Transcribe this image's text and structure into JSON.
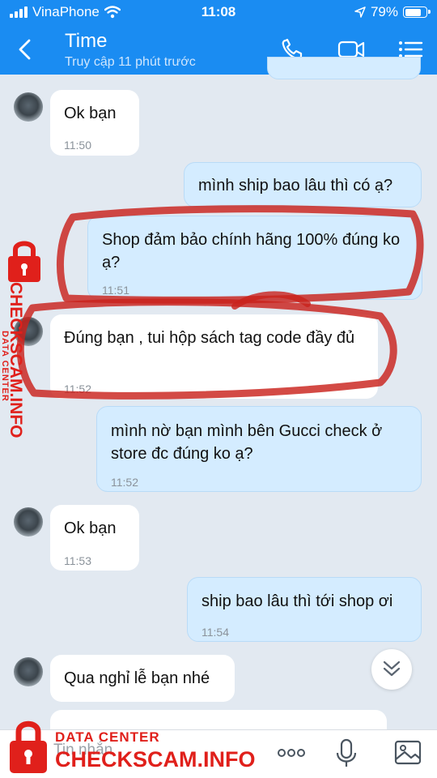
{
  "status": {
    "carrier": "VinaPhone",
    "time": "11:08",
    "battery": "79%",
    "battery_level": 0.79
  },
  "header": {
    "title": "Time",
    "subtitle": "Truy cập 11 phút trước"
  },
  "messages": [
    {
      "side": "in",
      "text": "Ok bạn",
      "time": "11:50"
    },
    {
      "side": "out",
      "text": "mình ship bao lâu thì có ạ?"
    },
    {
      "side": "out",
      "text": "Shop đảm bảo chính hãng 100% đúng ko ạ?",
      "time": "11:51"
    },
    {
      "side": "in",
      "text": "Đúng bạn , tui hộp sách tag code đầy đủ",
      "time": "11:52"
    },
    {
      "side": "out",
      "text": "mình nờ bạn mình bên Gucci check ở store đc đúng ko ạ?",
      "time": "11:52"
    },
    {
      "side": "in",
      "text": "Ok bạn",
      "time": "11:53"
    },
    {
      "side": "out",
      "text": "ship bao lâu thì tới shop ơi",
      "time": "11:54"
    },
    {
      "side": "in",
      "text": "Qua nghỉ lễ bạn nhé"
    }
  ],
  "input": {
    "placeholder": "Tin nhắn"
  },
  "watermark": {
    "line1": "DATA CENTER",
    "line2": "CHECKSCAM.INFO"
  },
  "colors": {
    "header": "#1a8cf2",
    "background": "#e2e9f1",
    "outgoing": "#d4ecff",
    "incoming": "#ffffff",
    "watermark": "#e0201b"
  },
  "icons": [
    "back-icon",
    "phone-icon",
    "video-call-icon",
    "menu-icon",
    "chevron-down-icon",
    "more-icon",
    "mic-icon",
    "image-icon",
    "lock-icon"
  ]
}
